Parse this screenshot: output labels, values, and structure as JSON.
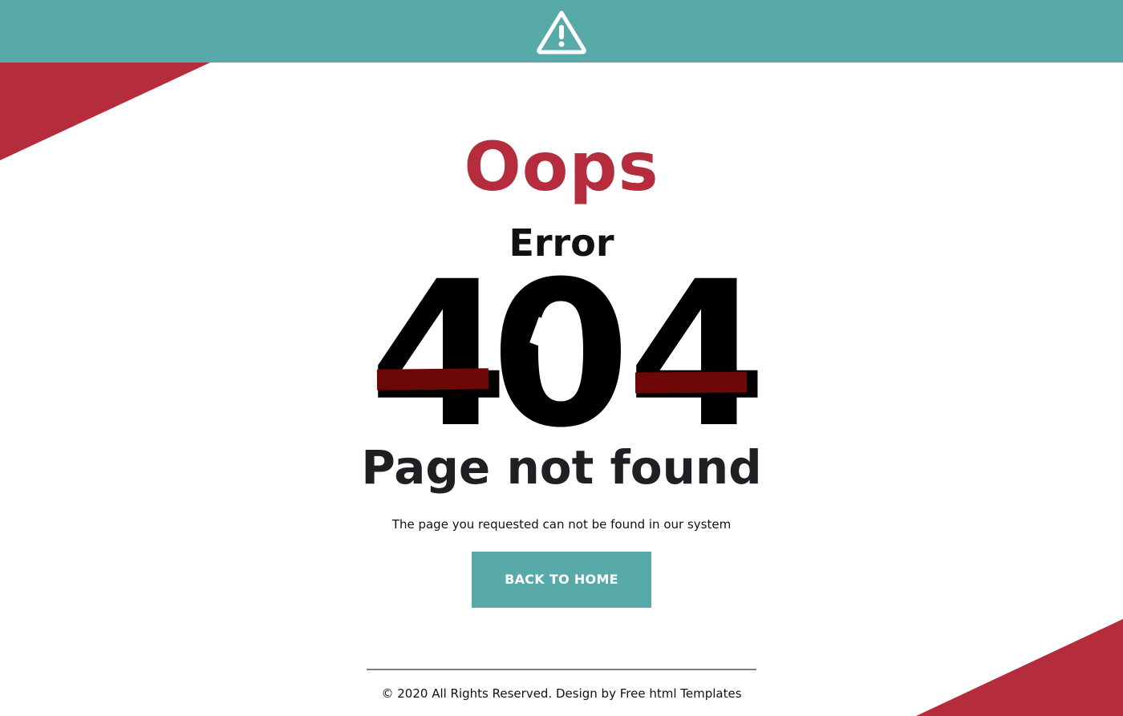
{
  "header": {
    "icon": "warning-triangle-icon",
    "color": "#58aaa8"
  },
  "main": {
    "title": "Oops",
    "subtitle": "Error",
    "code": [
      "4",
      "0",
      "4"
    ],
    "headline": "Page not found",
    "message": "The page you requested can not be found in our system",
    "button_label": "BACK TO HOME"
  },
  "footer": {
    "copyright": "© 2020 All Rights Reserved. Design by Free html Templates"
  },
  "colors": {
    "accent": "#58aaa8",
    "brand_red": "#b52d3d",
    "dark_red": "#6e0708",
    "text_dark": "#1f2024"
  }
}
